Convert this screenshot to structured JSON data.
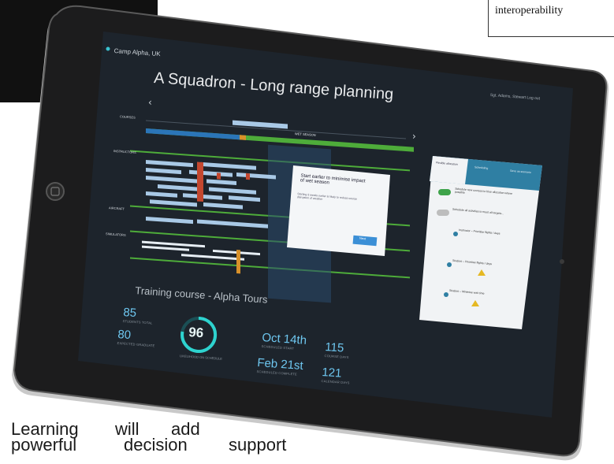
{
  "corner_caption": "interoperability",
  "app": {
    "location": "Camp Alpha, UK",
    "title": "A Squadron - Long range planning",
    "user_meta": "Sgt. Adams, Stewart  Log out",
    "rows": [
      "COURSES",
      "INSTRUCTORS",
      "AIRCRAFT",
      "SIMULATORS"
    ],
    "alert_chip": "WET SEASON",
    "popup": {
      "title": "Start earlier to minimise impact of wet season",
      "body": "Starting 3 weeks earlier is likely to reduce course disruption of weather",
      "button": "Next"
    },
    "panel": {
      "tabs": [
        "Flexible allocation",
        "Scheduling",
        "Save as scenario"
      ],
      "options": [
        "Schedule new courses to blue allocation where possible",
        "Schedule all activities to meet all targets...",
        "Instructor – Prioritise flights / days"
      ],
      "sections": [
        "Student – Prioritise flights / days",
        "Student – Minimise wait time"
      ]
    },
    "course_title": "Training course - Alpha Tours",
    "stats": [
      {
        "value": "85",
        "label": "STUDENTS TOTAL"
      },
      {
        "value": "80",
        "label": "EXPECTED GRADUATE"
      },
      {
        "value": "96",
        "label": "LIKELIHOOD ON SCHEDULE"
      },
      {
        "value": "Oct 14th",
        "label": "SCHEDULED START"
      },
      {
        "value": "Feb 21st",
        "label": "SCHEDULED COMPLETE"
      },
      {
        "value": "115",
        "label": "COURSE DAYS"
      },
      {
        "value": "121",
        "label": "CALENDAR DAYS"
      }
    ]
  },
  "bottom_text": {
    "line1": [
      "Learning",
      "will",
      "add"
    ],
    "line2": [
      "powerful",
      "decision",
      "support"
    ]
  }
}
